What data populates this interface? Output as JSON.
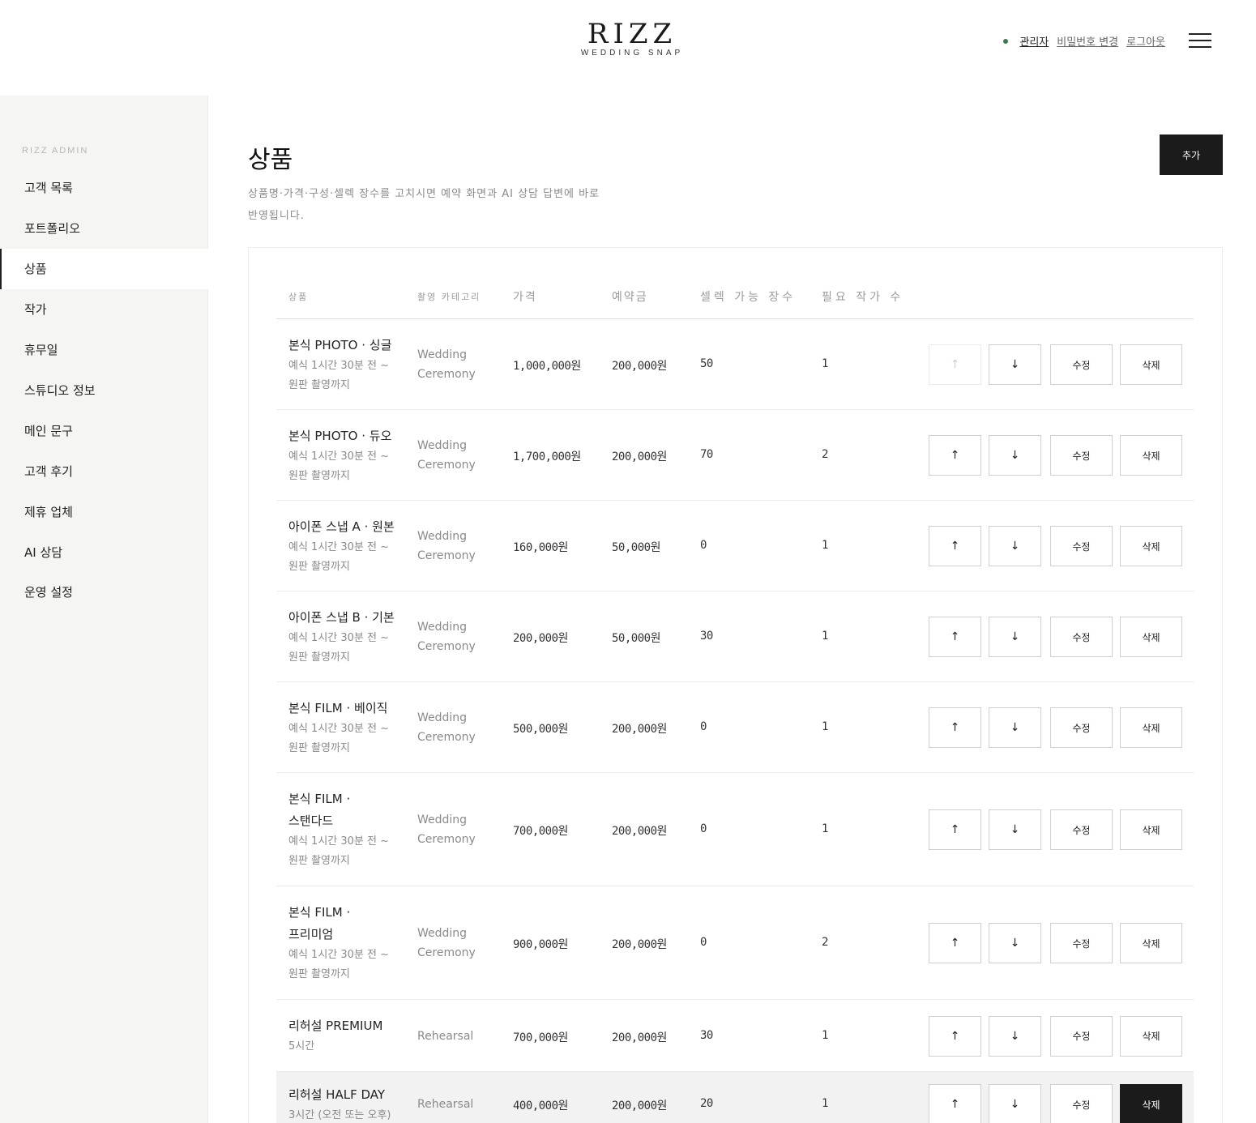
{
  "brand": {
    "name": "RIZZ",
    "tagline": "WEDDING SNAP"
  },
  "top_nav": {
    "admin": "관리자",
    "change_password": "비밀번호 변경",
    "logout": "로그아웃"
  },
  "sidebar": {
    "title": "RIZZ ADMIN",
    "items": [
      {
        "label": "고객 목록"
      },
      {
        "label": "포트폴리오"
      },
      {
        "label": "상품",
        "active": true
      },
      {
        "label": "작가"
      },
      {
        "label": "휴무일"
      },
      {
        "label": "스튜디오 정보"
      },
      {
        "label": "메인 문구"
      },
      {
        "label": "고객 후기"
      },
      {
        "label": "제휴 업체"
      },
      {
        "label": "AI 상담"
      },
      {
        "label": "운영 설정"
      }
    ]
  },
  "page": {
    "title": "상품",
    "desc_line1": "상품명·가격·구성·셀렉 장수를 고치시면 예약 화면과 AI 상담 답변에 바로",
    "desc_line2": "반영됩니다.",
    "add_label": "추가"
  },
  "table": {
    "headers": {
      "product": "상품",
      "category": "촬영 카테고리",
      "price": "가격",
      "deposit": "예약금",
      "select": "셀렉 가능 장수",
      "photographers": "필요 작가 수"
    },
    "up_label": "↑",
    "down_label": "↓",
    "edit_label": "수정",
    "delete_label": "삭제",
    "rows": [
      {
        "name1": "본식 PHOTO · 싱글",
        "name2": "",
        "desc1": "예식 1시간 30분 전 ~",
        "desc2": "원판 촬영까지",
        "cat1": "Wedding",
        "cat2": "Ceremony",
        "price": "1,000,000원",
        "deposit": "200,000원",
        "select": "50",
        "photographers": "1",
        "up_disabled": true
      },
      {
        "name1": "본식 PHOTO · 듀오",
        "name2": "",
        "desc1": "예식 1시간 30분 전 ~",
        "desc2": "원판 촬영까지",
        "cat1": "Wedding",
        "cat2": "Ceremony",
        "price": "1,700,000원",
        "deposit": "200,000원",
        "select": "70",
        "photographers": "2"
      },
      {
        "name1": "아이폰 스냅 A · 원본",
        "name2": "",
        "desc1": "예식 1시간 30분 전 ~",
        "desc2": "원판 촬영까지",
        "cat1": "Wedding",
        "cat2": "Ceremony",
        "price": "160,000원",
        "deposit": "50,000원",
        "select": "0",
        "photographers": "1"
      },
      {
        "name1": "아이폰 스냅 B · 기본",
        "name2": "",
        "desc1": "예식 1시간 30분 전 ~",
        "desc2": "원판 촬영까지",
        "cat1": "Wedding",
        "cat2": "Ceremony",
        "price": "200,000원",
        "deposit": "50,000원",
        "select": "30",
        "photographers": "1"
      },
      {
        "name1": "본식 FILM · 베이직",
        "name2": "",
        "desc1": "예식 1시간 30분 전 ~",
        "desc2": "원판 촬영까지",
        "cat1": "Wedding",
        "cat2": "Ceremony",
        "price": "500,000원",
        "deposit": "200,000원",
        "select": "0",
        "photographers": "1"
      },
      {
        "name1": "본식 FILM ·",
        "name2": "스탠다드",
        "desc1": "예식 1시간 30분 전 ~",
        "desc2": "원판 촬영까지",
        "cat1": "Wedding",
        "cat2": "Ceremony",
        "price": "700,000원",
        "deposit": "200,000원",
        "select": "0",
        "photographers": "1"
      },
      {
        "name1": "본식 FILM ·",
        "name2": "프리미엄",
        "desc1": "예식 1시간 30분 전 ~",
        "desc2": "원판 촬영까지",
        "cat1": "Wedding",
        "cat2": "Ceremony",
        "price": "900,000원",
        "deposit": "200,000원",
        "select": "0",
        "photographers": "2"
      },
      {
        "name1": "리허설 PREMIUM",
        "name2": "",
        "desc1": "5시간",
        "desc2": "",
        "cat1": "Rehearsal",
        "cat2": "",
        "price": "700,000원",
        "deposit": "200,000원",
        "select": "30",
        "photographers": "1"
      },
      {
        "name1": "리허설 HALF DAY",
        "name2": "",
        "desc1": "3시간 (오전 또는 오후)",
        "desc2": "",
        "cat1": "Rehearsal",
        "cat2": "",
        "price": "400,000원",
        "deposit": "200,000원",
        "select": "20",
        "photographers": "1",
        "highlight": true,
        "delete_dark": true
      }
    ]
  }
}
